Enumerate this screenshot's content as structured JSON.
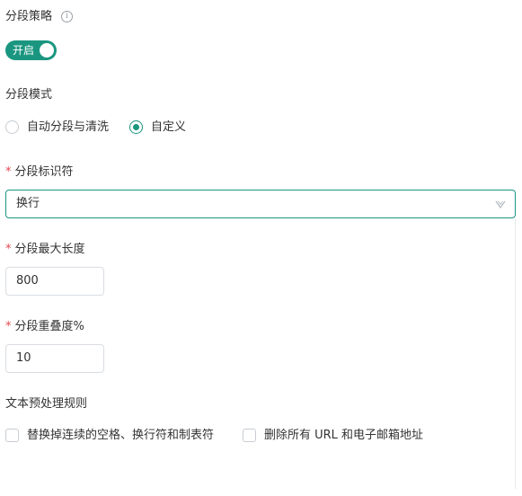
{
  "strategy": {
    "label": "分段策略",
    "info_icon": "info-icon",
    "toggle_label": "开启",
    "enabled": true
  },
  "mode": {
    "label": "分段模式",
    "options": [
      {
        "label": "自动分段与清洗",
        "checked": false
      },
      {
        "label": "自定义",
        "checked": true
      }
    ]
  },
  "separator": {
    "required_mark": "*",
    "label": "分段标识符",
    "value": "换行",
    "arrow_icon": "chevron-down-icon"
  },
  "max_length": {
    "required_mark": "*",
    "label": "分段最大长度",
    "value": "800"
  },
  "overlap": {
    "required_mark": "*",
    "label": "分段重叠度%",
    "value": "10"
  },
  "preprocess": {
    "label": "文本预处理规则",
    "rules": [
      {
        "label": "替换掉连续的空格、换行符和制表符",
        "checked": false
      },
      {
        "label": "删除所有 URL 和电子邮箱地址",
        "checked": false
      }
    ]
  },
  "colors": {
    "accent": "#1a9680",
    "required": "#e5484d",
    "text": "#333333",
    "border": "#d9dde2"
  }
}
